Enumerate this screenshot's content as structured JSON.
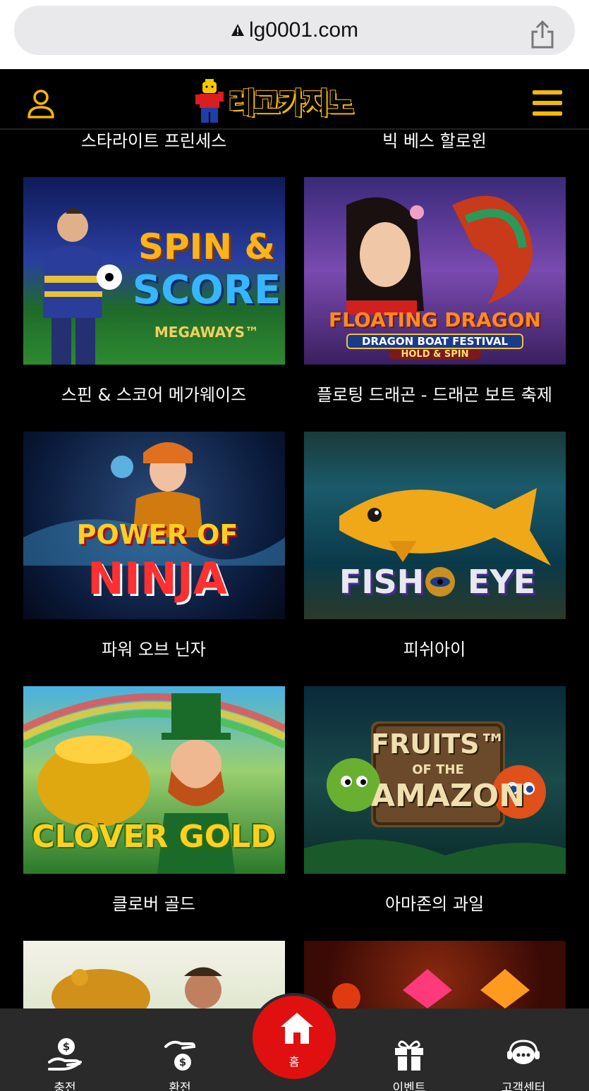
{
  "browser": {
    "url": "lg0001.com"
  },
  "header": {
    "logo_text": "레고카지노"
  },
  "games": {
    "top_row_labels": [
      "스타라이트 프린세스",
      "빅 베스 할로윈"
    ],
    "items": [
      {
        "title": "스핀 & 스코어 메가웨이즈",
        "art": [
          "SPIN &",
          "SCORE",
          "MEGAWAYS™"
        ]
      },
      {
        "title": "플로팅 드래곤 - 드래곤 보트 축제",
        "art": [
          "FLOATING DRAGON",
          "DRAGON BOAT FESTIVAL",
          "HOLD & SPIN"
        ]
      },
      {
        "title": "파워 오브 닌자",
        "art": [
          "POWER OF",
          "NINJA"
        ]
      },
      {
        "title": "피쉬아이",
        "art": [
          "FISH",
          "EYE"
        ]
      },
      {
        "title": "클로버 골드",
        "art": [
          "CLOVER GOLD"
        ]
      },
      {
        "title": "아마존의 과일",
        "art": [
          "FRUITS™",
          "OF THE",
          "AMAZON"
        ]
      }
    ]
  },
  "bottom_nav": {
    "deposit": "충전",
    "withdraw": "환전",
    "home": "홈",
    "events": "이벤트",
    "support": "고객센터"
  },
  "colors": {
    "accent": "#f5b800",
    "home_button": "#e01010",
    "nav_bg": "#2a2a2a"
  }
}
